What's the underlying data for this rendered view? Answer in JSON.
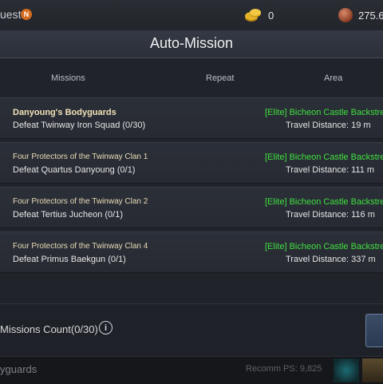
{
  "topbar": {
    "quest_label": "uest",
    "quest_badge": "N",
    "coin_value": "0",
    "gem_value": "275.6"
  },
  "panel": {
    "title": "Auto-Mission",
    "headers": {
      "missions": "Missions",
      "repeat": "Repeat",
      "area": "Area"
    },
    "rows": [
      {
        "title": "Danyoung's Bodyguards",
        "objective": "Defeat Twinway Iron Squad (0/30)",
        "area": "[Elite] Bicheon Castle Backstre",
        "distance": "Travel Distance: 19 m"
      },
      {
        "title": "Four Protectors of the Twinway Clan 1",
        "objective": "Defeat Quartus Danyoung (0/1)",
        "area": "[Elite] Bicheon Castle Backstre",
        "distance": "Travel Distance: 111 m"
      },
      {
        "title": "Four Protectors of the Twinway Clan 2",
        "objective": "Defeat Tertius Jucheon (0/1)",
        "area": "[Elite] Bicheon Castle Backstre",
        "distance": "Travel Distance: 116 m"
      },
      {
        "title": "Four Protectors of the Twinway Clan 4",
        "objective": "Defeat Primus Baekgun (0/1)",
        "area": "[Elite] Bicheon Castle Backstre",
        "distance": "Travel Distance: 337 m"
      }
    ],
    "missions_count": "Missions Count(0/30)",
    "info_glyph": "i"
  },
  "bottombar": {
    "left_text": "yguards",
    "ps_text": "Recomm PS: 9,825"
  },
  "colors": {
    "area_green": "#3fe03f",
    "badge_orange": "#d46a1c"
  }
}
